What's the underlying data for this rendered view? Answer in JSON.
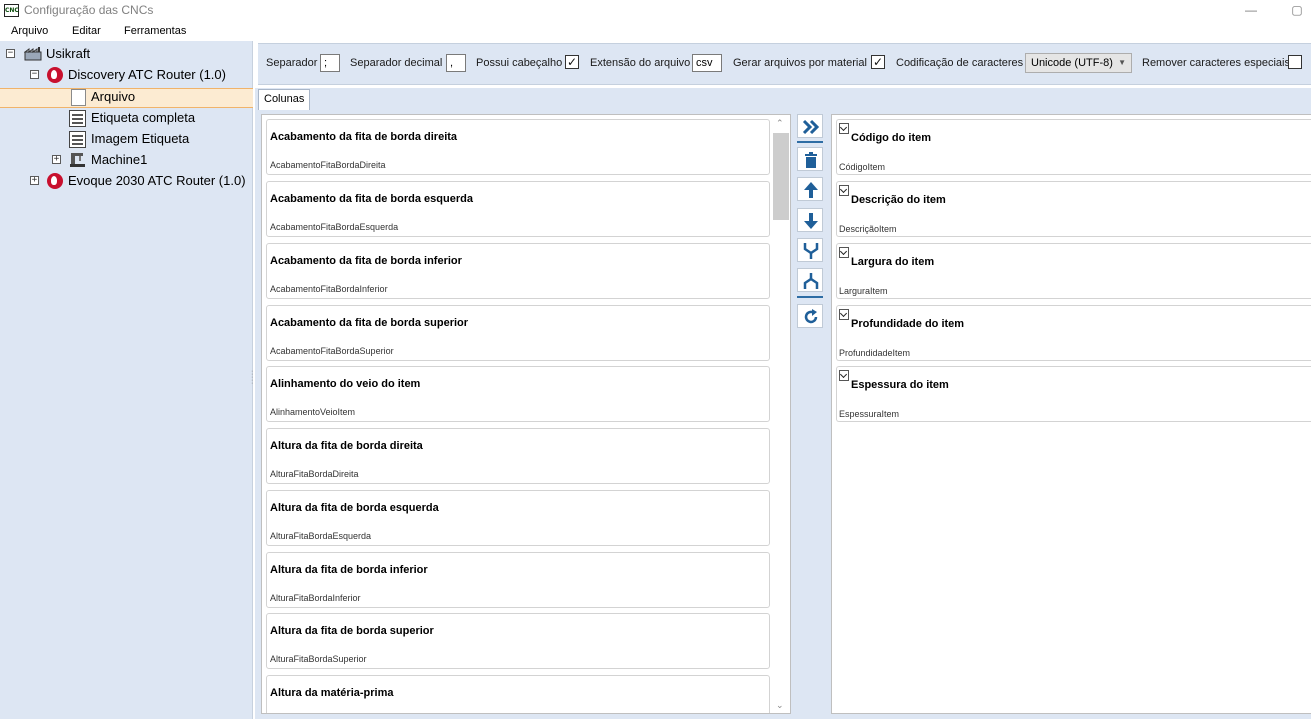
{
  "window": {
    "title": "Configuração das CNCs",
    "icon_text": "CNC",
    "minimize_glyph": "—",
    "restore_glyph": "▢"
  },
  "menu": [
    "Arquivo",
    "Editar",
    "Ferramentas"
  ],
  "tree": {
    "root": "Usikraft",
    "machine1": "Discovery ATC Router (1.0)",
    "children": [
      "Arquivo",
      "Etiqueta completa",
      "Imagem Etiqueta",
      "Machine1"
    ],
    "machine2": "Evoque 2030 ATC Router (1.0)",
    "selected": "Arquivo"
  },
  "toolbar": {
    "separator_label": "Separador",
    "separator_value": ";",
    "decimal_label": "Separador decimal",
    "decimal_value": ",",
    "header_label": "Possui cabeçalho",
    "header_checked": true,
    "extension_label": "Extensão do arquivo",
    "extension_value": "csv",
    "per_material_label": "Gerar arquivos por material",
    "per_material_checked": true,
    "encoding_label": "Codificação de caracteres",
    "encoding_value": "Unicode (UTF-8)",
    "remove_special_label": "Remover caracteres especiais",
    "remove_special_checked": false,
    "check_glyph": "✓"
  },
  "tabs": [
    "Colunas"
  ],
  "available_columns": [
    {
      "title": "Acabamento da fita de borda direita",
      "field": "AcabamentoFitaBordaDireita"
    },
    {
      "title": "Acabamento da fita de borda esquerda",
      "field": "AcabamentoFitaBordaEsquerda"
    },
    {
      "title": "Acabamento da fita de borda inferior",
      "field": "AcabamentoFitaBordaInferior"
    },
    {
      "title": "Acabamento da fita de borda superior",
      "field": "AcabamentoFitaBordaSuperior"
    },
    {
      "title": "Alinhamento do veio do item",
      "field": "AlinhamentoVeioItem"
    },
    {
      "title": "Altura da fita de borda direita",
      "field": "AlturaFitaBordaDireita"
    },
    {
      "title": "Altura da fita de borda esquerda",
      "field": "AlturaFitaBordaEsquerda"
    },
    {
      "title": "Altura da fita de borda inferior",
      "field": "AlturaFitaBordaInferior"
    },
    {
      "title": "Altura da fita de borda superior",
      "field": "AlturaFitaBordaSuperior"
    },
    {
      "title": "Altura da matéria-prima",
      "field": ""
    }
  ],
  "selected_columns": [
    {
      "title": "Código do item",
      "field": "CódigoItem"
    },
    {
      "title": "Descrição do item",
      "field": "DescriçãoItem"
    },
    {
      "title": "Largura do item",
      "field": "LarguraItem"
    },
    {
      "title": "Profundidade do item",
      "field": "ProfundidadeItem"
    },
    {
      "title": "Espessura do item",
      "field": "EspessuraItem"
    }
  ],
  "action_icons": [
    "add-all-icon",
    "delete-icon",
    "move-up-icon",
    "move-down-icon",
    "merge-icon",
    "split-icon",
    "refresh-icon"
  ],
  "colors": {
    "panel_bg": "#dde6f3",
    "selection_bg": "#fcebd2",
    "selection_border": "#f0b36a",
    "accent_blue": "#2e6da4"
  }
}
